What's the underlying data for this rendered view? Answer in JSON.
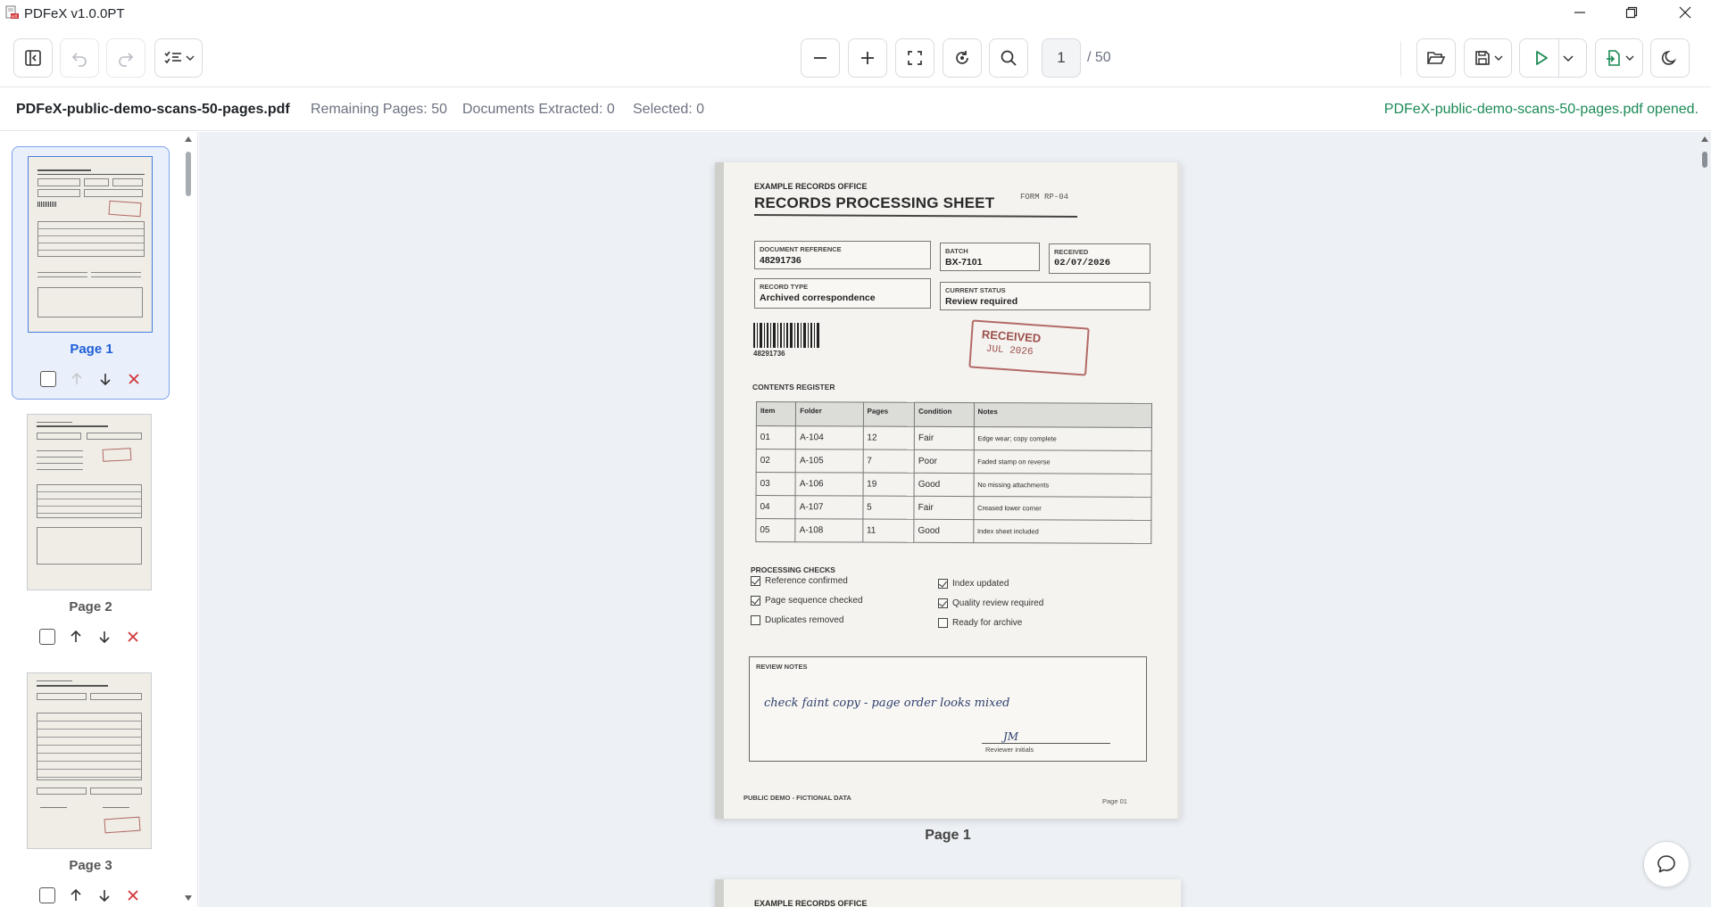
{
  "app": {
    "title": "PDFeX v1.0.0PT"
  },
  "window_controls": {
    "minimize": "minimize",
    "restore": "restore",
    "close": "close"
  },
  "toolbar": {
    "current_page": "1",
    "total_pages": "/ 50"
  },
  "infobar": {
    "filename": "PDFeX-public-demo-scans-50-pages.pdf",
    "remaining": "Remaining Pages: 50",
    "extracted": "Documents Extracted: 0",
    "selected": "Selected: 0",
    "status": "PDFeX-public-demo-scans-50-pages.pdf opened."
  },
  "sidebar": {
    "thumbnails": [
      {
        "label": "Page 1"
      },
      {
        "label": "Page 2"
      },
      {
        "label": "Page 3"
      }
    ]
  },
  "viewer": {
    "page_label": "Page 1"
  },
  "document": {
    "office": "EXAMPLE RECORDS OFFICE",
    "title": "RECORDS PROCESSING SHEET",
    "form": "FORM RP-04",
    "fields": {
      "doc_ref_label": "DOCUMENT REFERENCE",
      "doc_ref_value": "48291736",
      "batch_label": "BATCH",
      "batch_value": "BX-7101",
      "received_label": "RECEIVED",
      "received_value": "02/07/2026",
      "record_type_label": "RECORD TYPE",
      "record_type_value": "Archived correspondence",
      "status_label": "CURRENT STATUS",
      "status_value": "Review required"
    },
    "barcode_number": "48291736",
    "stamp": {
      "line1": "RECEIVED",
      "line2": "JUL 2026"
    },
    "register_title": "CONTENTS REGISTER",
    "register_headers": [
      "Item",
      "Folder",
      "Pages",
      "Condition",
      "Notes"
    ],
    "register_rows": [
      [
        "01",
        "A-104",
        "12",
        "Fair",
        "Edge wear; copy complete"
      ],
      [
        "02",
        "A-105",
        "7",
        "Poor",
        "Faded stamp on reverse"
      ],
      [
        "03",
        "A-106",
        "19",
        "Good",
        "No missing attachments"
      ],
      [
        "04",
        "A-107",
        "5",
        "Fair",
        "Creased lower corner"
      ],
      [
        "05",
        "A-108",
        "11",
        "Good",
        "Index sheet included"
      ]
    ],
    "checks_title": "PROCESSING CHECKS",
    "checks": [
      {
        "label": "Reference confirmed",
        "checked": true
      },
      {
        "label": "Page sequence checked",
        "checked": true
      },
      {
        "label": "Duplicates removed",
        "checked": false
      },
      {
        "label": "Index updated",
        "checked": true
      },
      {
        "label": "Quality review required",
        "checked": true
      },
      {
        "label": "Ready for archive",
        "checked": false
      }
    ],
    "notes_title": "REVIEW NOTES",
    "notes_text": "check faint copy - page order looks mixed",
    "signature": "JM",
    "signature_label": "Reviewer initials",
    "footer": "PUBLIC DEMO - FICTIONAL DATA",
    "page_number": "Page 01",
    "next_page_office": "EXAMPLE RECORDS OFFICE"
  },
  "colors": {
    "accent": "#1f5fd6",
    "success": "#1a8a55",
    "play": "#1a8a55",
    "danger": "#d13438",
    "stamp": "#b36a66"
  }
}
